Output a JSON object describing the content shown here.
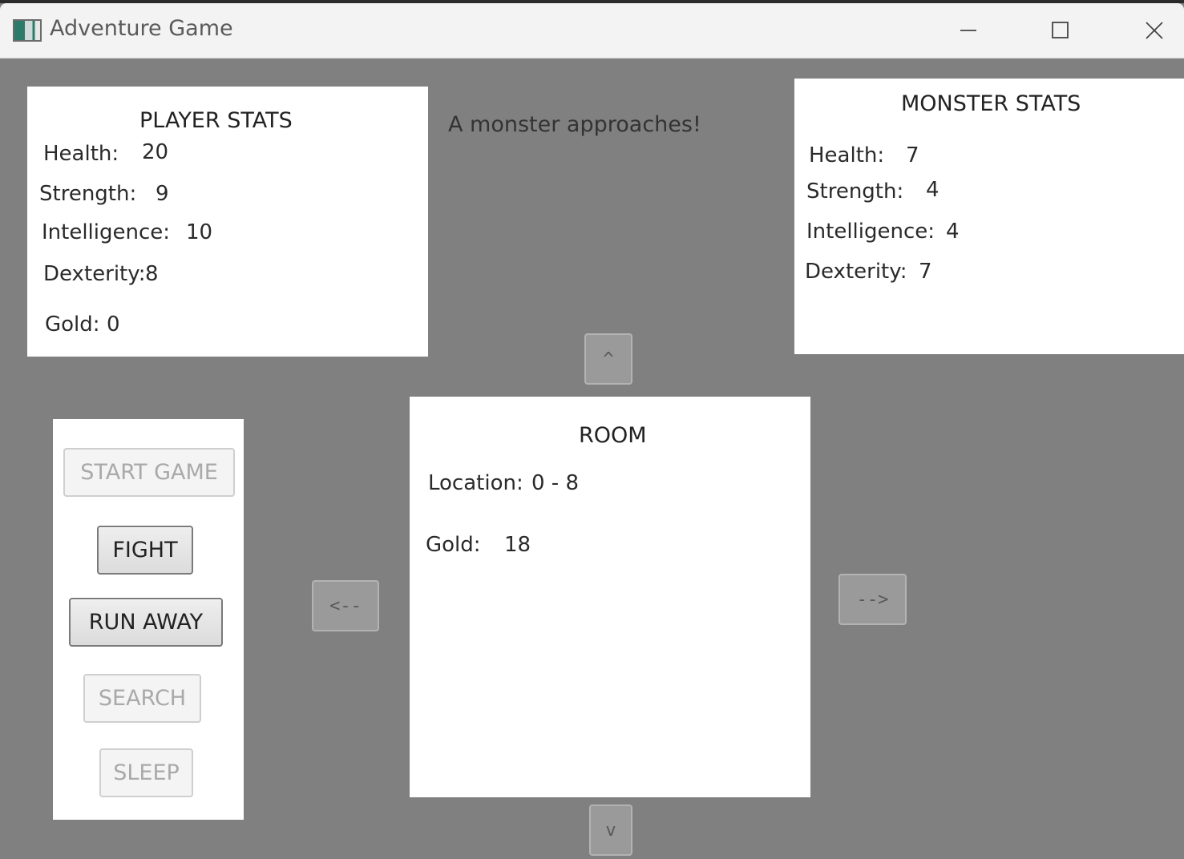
{
  "window": {
    "title": "Adventure Game"
  },
  "message": "A monster approaches!",
  "player_stats": {
    "title": "PLAYER STATS",
    "health_label": "Health:",
    "health_value": "20",
    "strength_label": "Strength:",
    "strength_value": "9",
    "intelligence_label": "Intelligence:",
    "intelligence_value": "10",
    "dexterity_label": "Dexterity:",
    "dexterity_value": "8",
    "gold_label": "Gold:",
    "gold_value": "0"
  },
  "monster_stats": {
    "title": "MONSTER STATS",
    "health_label": "Health:",
    "health_value": "7",
    "strength_label": "Strength:",
    "strength_value": "4",
    "intelligence_label": "Intelligence:",
    "intelligence_value": "4",
    "dexterity_label": "Dexterity:",
    "dexterity_value": "7"
  },
  "room": {
    "title": "ROOM",
    "location_label": "Location:",
    "location_value": "0 - 8",
    "gold_label": "Gold:",
    "gold_value": "18"
  },
  "actions": {
    "start_game": {
      "label": "START GAME",
      "enabled": false
    },
    "fight": {
      "label": "FIGHT",
      "enabled": true
    },
    "run_away": {
      "label": "RUN AWAY",
      "enabled": true
    },
    "search": {
      "label": "SEARCH",
      "enabled": false
    },
    "sleep": {
      "label": "SLEEP",
      "enabled": false
    }
  },
  "navigation": {
    "up": "^",
    "down": "v",
    "left": "<--",
    "right": "-->"
  },
  "colors": {
    "background": "#808080",
    "panel": "#ffffff",
    "titlebar": "#f3f3f3"
  }
}
